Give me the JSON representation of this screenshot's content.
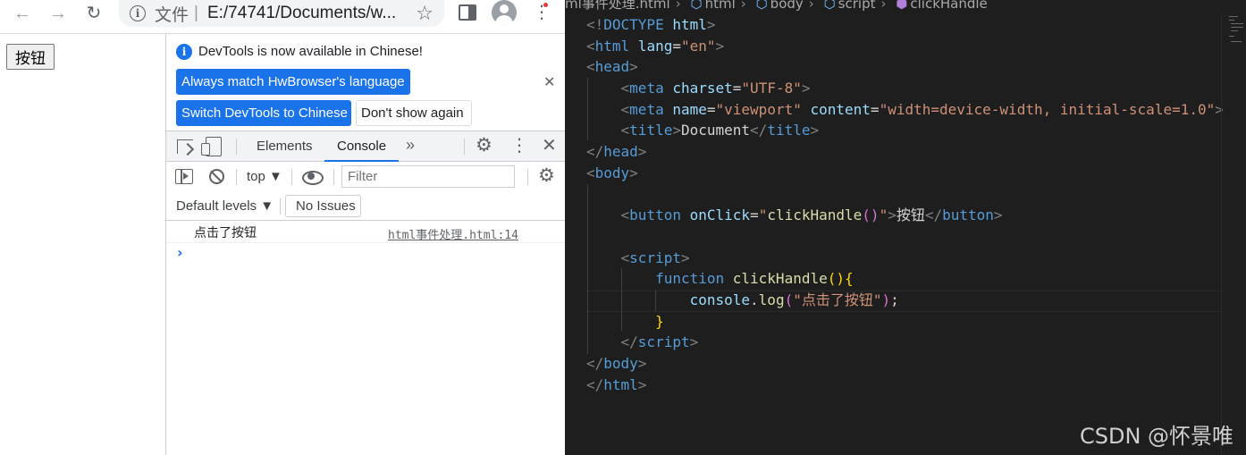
{
  "browser": {
    "omnibox": {
      "prefix": "文件",
      "separator": "|",
      "url": "E:/74741/Documents/w..."
    },
    "icons": {
      "back": "back-arrow-icon",
      "forward": "forward-arrow-icon",
      "reload": "reload-icon",
      "info": "info-icon",
      "star": "bookmark-star-icon",
      "side_panel": "side-panel-icon",
      "profile": "profile-avatar-icon",
      "menu": "kebab-menu-icon"
    },
    "page": {
      "button_label": "按钮"
    }
  },
  "devtools": {
    "infobar": {
      "message": "DevTools is now available in Chinese!",
      "match_button": "Always match HwBrowser's language",
      "switch_button": "Switch DevTools to Chinese",
      "dont_show_button": "Don't show again",
      "close": "✕"
    },
    "tabs": [
      {
        "label": "Elements"
      },
      {
        "label": "Console",
        "active": true
      }
    ],
    "more_tabs": "»",
    "console": {
      "context": "top ▼",
      "filter_placeholder": "Filter",
      "levels": "Default levels ▼",
      "issues": "No Issues",
      "log": [
        {
          "message": "点击了按钮",
          "source": "html事件处理.html:14"
        }
      ],
      "prompt": "›"
    },
    "accent_color": "#1a73e8"
  },
  "editor": {
    "breadcrumbs": [
      {
        "label": "ml事件处理.html",
        "icon": ""
      },
      {
        "label": "html",
        "icon": "cube-icon"
      },
      {
        "label": "body",
        "icon": "cube-icon"
      },
      {
        "label": "script",
        "icon": "cube-icon"
      },
      {
        "label": "clickHandle",
        "icon": "symbol-method-icon"
      }
    ],
    "background": "#1e1e1e",
    "watermark": "CSDN @怀景唯"
  }
}
